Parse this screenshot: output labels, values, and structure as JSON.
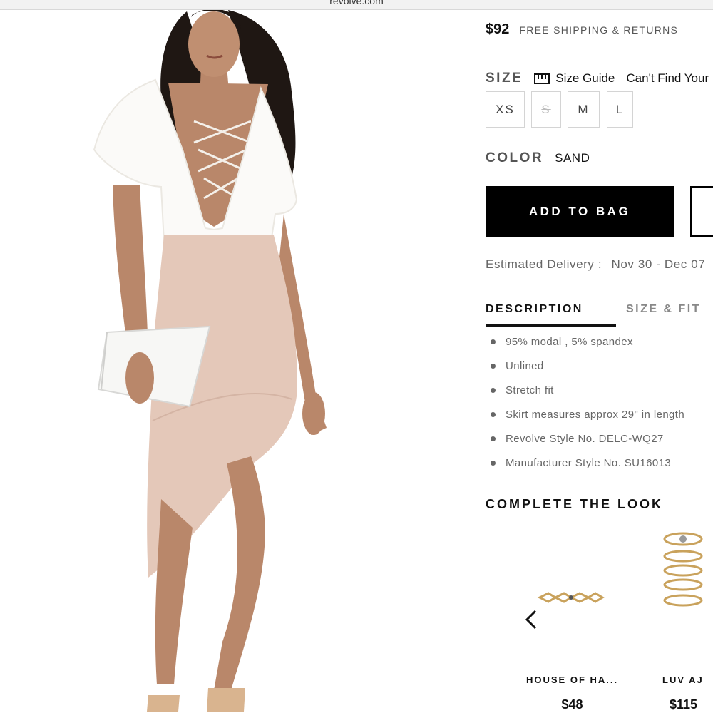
{
  "browser": {
    "url": "revolve.com"
  },
  "product": {
    "price": "$92",
    "shipping": "FREE SHIPPING & RETURNS",
    "size_label": "SIZE",
    "size_guide": "Size Guide",
    "cant_find": "Can't Find Your",
    "sizes": [
      {
        "label": "XS",
        "available": true
      },
      {
        "label": "S",
        "available": false
      },
      {
        "label": "M",
        "available": true
      },
      {
        "label": "L",
        "available": true
      }
    ],
    "color_label": "COLOR",
    "color_value": "SAND",
    "add_to_bag": "ADD TO BAG",
    "delivery_label": "Estimated Delivery :",
    "delivery_value": "Nov 30 - Dec 07"
  },
  "tabs": {
    "description": "DESCRIPTION",
    "size_fit": "SIZE & FIT"
  },
  "description": [
    "95% modal , 5% spandex",
    "Unlined",
    "Stretch fit",
    "Skirt measures approx 29\" in length",
    "Revolve Style No. DELC-WQ27",
    "Manufacturer Style No. SU16013"
  ],
  "complete_the_look": {
    "title": "COMPLETE THE LOOK",
    "items": [
      {
        "brand": "HOUSE OF HA...",
        "price": "$48"
      },
      {
        "brand": "LUV AJ",
        "price": "$115"
      }
    ]
  },
  "colors": {
    "dress_top": "#fbfaf8",
    "dress_skirt": "#e4c8b9",
    "skin": "#b9876a",
    "hair": "#1f1713",
    "button_bg": "#000000",
    "ring_gold": "#c9a25c"
  },
  "icons": {
    "size_guide": "ruler-icon",
    "carousel_prev": "chevron-left-icon"
  }
}
